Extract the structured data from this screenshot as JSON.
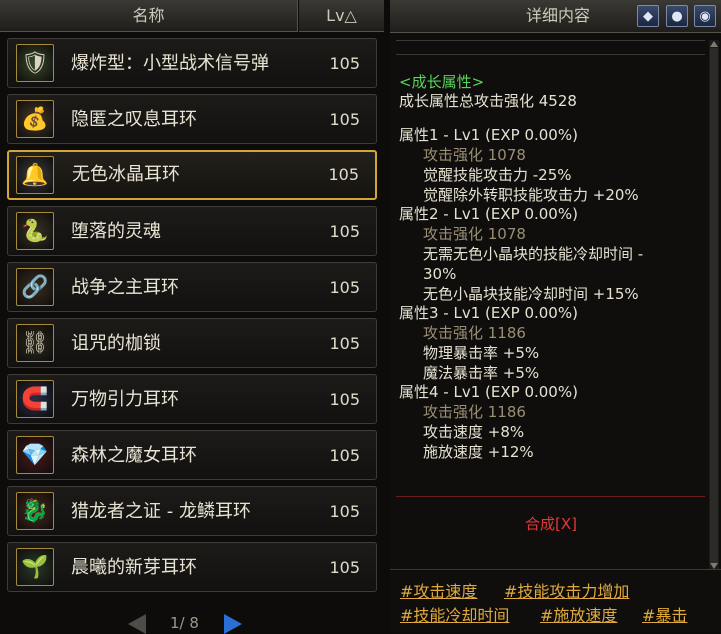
{
  "list_header": {
    "name_label": "名称",
    "lv_label": "Lv△"
  },
  "items": [
    {
      "name": "爆炸型：小型战术信号弹",
      "lv": "105",
      "icon": "grenade-icon",
      "glyph": "🛡",
      "color": "#3a4a2a"
    },
    {
      "name": "隐匿之叹息耳环",
      "lv": "105",
      "icon": "sack-earring-icon",
      "glyph": "💰",
      "color": "#4a3a2a"
    },
    {
      "name": "无色冰晶耳环",
      "lv": "105",
      "icon": "ice-crystal-earring-icon",
      "glyph": "🔔",
      "color": "#3d3d42"
    },
    {
      "name": "堕落的灵魂",
      "lv": "105",
      "icon": "fallen-soul-icon",
      "glyph": "🐍",
      "color": "#3a3326"
    },
    {
      "name": "战争之主耳环",
      "lv": "105",
      "icon": "warlord-earring-icon",
      "glyph": "🔗",
      "color": "#3b2f1f"
    },
    {
      "name": "诅咒的枷锁",
      "lv": "105",
      "icon": "cursed-shackle-icon",
      "glyph": "⛓",
      "color": "#2f2a1e"
    },
    {
      "name": "万物引力耳环",
      "lv": "105",
      "icon": "gravity-earring-icon",
      "glyph": "🧲",
      "color": "#2a2f4a"
    },
    {
      "name": "森林之魔女耳环",
      "lv": "105",
      "icon": "forest-witch-earring-icon",
      "glyph": "💎",
      "color": "#4a1a1a"
    },
    {
      "name": "猎龙者之证 - 龙鳞耳环",
      "lv": "105",
      "icon": "dragon-scale-earring-icon",
      "glyph": "🐉",
      "color": "#4a2a20"
    },
    {
      "name": "晨曦的新芽耳环",
      "lv": "105",
      "icon": "sprout-earring-icon",
      "glyph": "🌱",
      "color": "#2a3a2a"
    }
  ],
  "selected_index": 2,
  "pager": {
    "text": "1/ 8"
  },
  "detail": {
    "title": "详细内容",
    "growth_header": "<成长属性>",
    "total": "成长属性总攻击强化 4528",
    "attrs": [
      {
        "title": "属性1 - Lv1 (EXP 0.00%)",
        "atk": "攻击强化 1078",
        "effects": [
          "觉醒技能攻击力 -25%",
          "觉醒除外转职技能攻击力 +20%"
        ]
      },
      {
        "title": "属性2 - Lv1 (EXP 0.00%)",
        "atk": "攻击强化 1078",
        "effects": [
          "无需无色小晶块的技能冷却时间 -",
          "30%",
          "无色小晶块技能冷却时间 +15%"
        ]
      },
      {
        "title": "属性3 - Lv1 (EXP 0.00%)",
        "atk": "攻击强化 1186",
        "effects": [
          "物理暴击率 +5%",
          "魔法暴击率 +5%"
        ]
      },
      {
        "title": "属性4 - Lv1 (EXP 0.00%)",
        "atk": "攻击强化 1186",
        "effects": [
          "攻击速度 +8%",
          "施放速度 +12%"
        ]
      }
    ],
    "synthesis": "合成[X]"
  },
  "tags": [
    "#攻击速度",
    "#技能攻击力增加",
    "#技能冷却时间",
    "#施放速度",
    "#暴击"
  ]
}
